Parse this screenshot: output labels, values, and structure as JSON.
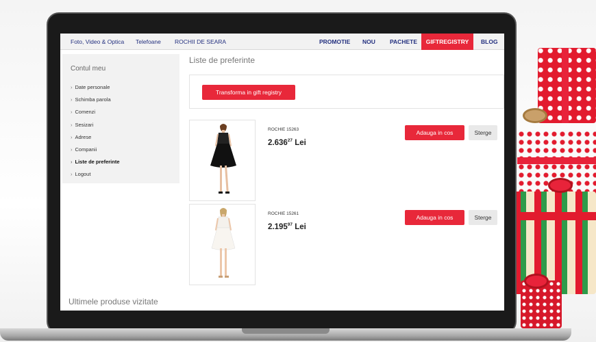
{
  "nav": {
    "left": [
      "Foto, Video & Optica",
      "Telefoane",
      "ROCHII DE SEARA"
    ],
    "right": [
      "PROMOTIE",
      "NOU",
      "PACHETE",
      "GIFTREGISTRY",
      "BLOG"
    ]
  },
  "sidebar": {
    "title": "Contul meu",
    "items": [
      {
        "label": "Date personale"
      },
      {
        "label": "Schimba parola"
      },
      {
        "label": "Comenzi"
      },
      {
        "label": "Sesizari"
      },
      {
        "label": "Adrese"
      },
      {
        "label": "Companii"
      },
      {
        "label": "Liste de preferinte"
      },
      {
        "label": "Logout"
      }
    ],
    "active_index": 6
  },
  "main": {
    "title": "Liste de preferinte",
    "convert_label": "Transforma in gift registry",
    "products": [
      {
        "name": "ROCHIE 15263",
        "price_main": "2.636",
        "price_dec": "27",
        "currency": "Lei",
        "add_label": "Adauga in cos",
        "remove_label": "Sterge"
      },
      {
        "name": "ROCHIE 15261",
        "price_main": "2.195",
        "price_dec": "97",
        "currency": "Lei",
        "add_label": "Adauga in cos",
        "remove_label": "Sterge"
      }
    ],
    "recent_title": "Ultimele produse vizitate"
  },
  "colors": {
    "accent": "#e8283a",
    "nav_text": "#23307f"
  }
}
